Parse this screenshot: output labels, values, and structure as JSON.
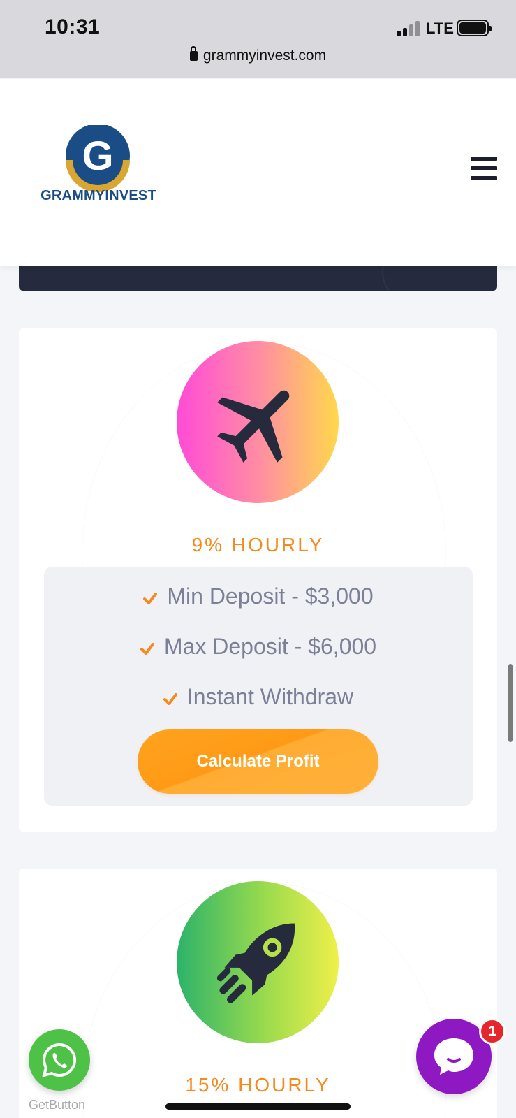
{
  "status_bar": {
    "time": "10:31",
    "network": "LTE",
    "url": "grammyinvest.com"
  },
  "header": {
    "logo_letter": "G",
    "logo_text": "GRAMMYINVEST",
    "menu_icon": "hamburger-menu-icon"
  },
  "plans": [
    {
      "icon": "airplane-icon",
      "rate": "9% HOURLY",
      "features": [
        "Min Deposit - $3,000",
        "Max Deposit - $6,000",
        "Instant Withdraw"
      ],
      "button_label": "Calculate Profit",
      "gradient": [
        "#ff4bd8",
        "#ffd84c"
      ]
    },
    {
      "icon": "rocket-icon",
      "rate": "15% HOURLY",
      "gradient": [
        "#2cb36a",
        "#eff04a"
      ]
    }
  ],
  "widgets": {
    "whatsapp_icon": "whatsapp-icon",
    "getbutton_label": "GetButton",
    "chat_icon": "chat-bubble-icon",
    "chat_badge_count": "1"
  },
  "colors": {
    "accent_orange": "#f58a1f",
    "logo_blue": "#1a4c86",
    "logo_gold": "#d9a632",
    "chat_purple": "#8e19c3",
    "whatsapp_green": "#4dc247"
  }
}
